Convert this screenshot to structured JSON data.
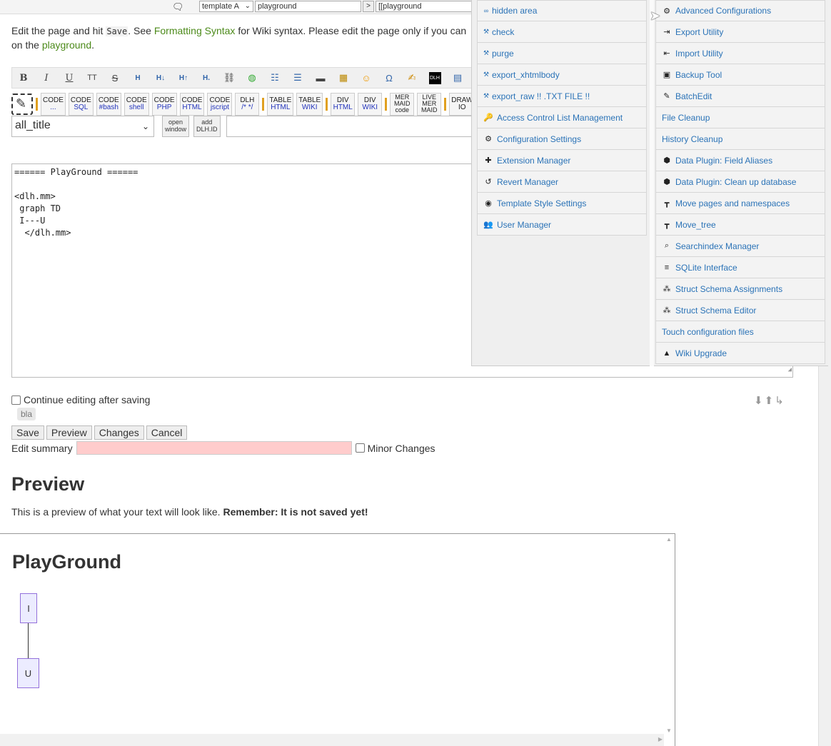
{
  "topbar": {
    "template_select": "template A",
    "page_input": "playground",
    "go_label": ">",
    "link_input": "[[playground"
  },
  "intro": {
    "text_a": "Edit the page and hit ",
    "save_code": "Save",
    "text_b": ". See ",
    "syntax_link": "Formatting Syntax",
    "text_c": " for Wiki syntax. Please edit the page only if you can ",
    "line2_a": "on the ",
    "playground_link": "playground",
    "line2_b": "."
  },
  "toolbar": {
    "format_buttons": [
      "B",
      "I",
      "U",
      "TT",
      "S"
    ],
    "dlh_badge": "DLH",
    "code_buttons": [
      {
        "l1": "CODE",
        "l2": "..."
      },
      {
        "l1": "CODE",
        "l2": "SQL"
      },
      {
        "l1": "CODE",
        "l2": "#bash"
      },
      {
        "l1": "CODE",
        "l2": "shell"
      },
      {
        "l1": "CODE",
        "l2": "PHP"
      },
      {
        "l1": "CODE",
        "l2": "HTML"
      },
      {
        "l1": "CODE",
        "l2": "jscript"
      },
      {
        "l1": "DLH",
        "l2": "/* */"
      }
    ],
    "table_buttons": [
      {
        "l1": "TABLE",
        "l2": "HTML"
      },
      {
        "l1": "TABLE",
        "l2": "WIKI"
      }
    ],
    "div_buttons": [
      {
        "l1": "DIV",
        "l2": "HTML"
      },
      {
        "l1": "DIV",
        "l2": "WIKI"
      }
    ],
    "mermaid_buttons": [
      {
        "l1": "MER",
        "l2": "MAID",
        "l3": "code"
      },
      {
        "l1": "LIVE",
        "l2": "MER",
        "l3": "MAID"
      }
    ],
    "drawio": {
      "l1": "DRAW",
      "l2": "IO"
    },
    "title_select": "all_title",
    "open_window": [
      "open",
      "window"
    ],
    "add_dlh": [
      "add",
      "DLH.ID"
    ]
  },
  "editor": {
    "lines": [
      "====== PlayGround ======",
      "",
      "<dlh.mm>",
      " graph TD",
      " I---U",
      "  </dlh.mm>"
    ]
  },
  "edit_controls": {
    "continue_label": "Continue editing after saving",
    "tag": "bla",
    "save": "Save",
    "preview": "Preview",
    "changes": "Changes",
    "cancel": "Cancel",
    "summary_label": "Edit summary",
    "minor_label": "Minor Changes"
  },
  "preview": {
    "heading": "Preview",
    "note_a": "This is a preview of what your text will look like. ",
    "note_b": "Remember: It is not saved yet!",
    "page_heading": "PlayGround",
    "node_top": "I",
    "node_bottom": "U"
  },
  "admin_menu": {
    "left": [
      {
        "icon": "link-icon",
        "glyph": "∞",
        "label": "hidden area"
      },
      {
        "icon": "wrench-icon",
        "glyph": "⚒",
        "label": "check"
      },
      {
        "icon": "wrench-icon",
        "glyph": "⚒",
        "label": "purge"
      },
      {
        "icon": "wrench-icon",
        "glyph": "⚒",
        "label": "export_xhtmlbody"
      },
      {
        "icon": "wrench-icon",
        "glyph": "⚒",
        "label": "export_raw !! .TXT FILE !!"
      },
      {
        "icon": "key-icon",
        "glyph": "🔑",
        "label": "Access Control List Management"
      },
      {
        "icon": "gear-icon",
        "glyph": "⚙",
        "label": "Configuration Settings"
      },
      {
        "icon": "puzzle-icon",
        "glyph": "✚",
        "label": "Extension Manager"
      },
      {
        "icon": "revert-icon",
        "glyph": "↺",
        "label": "Revert Manager"
      },
      {
        "icon": "palette-icon",
        "glyph": "◉",
        "label": "Template Style Settings"
      },
      {
        "icon": "users-icon",
        "glyph": "👥",
        "label": "User Manager"
      }
    ],
    "right": [
      {
        "icon": "gears-icon",
        "glyph": "⚙",
        "label": "Advanced Configurations"
      },
      {
        "icon": "export-icon",
        "glyph": "⇥",
        "label": "Export Utility"
      },
      {
        "icon": "import-icon",
        "glyph": "⇤",
        "label": "Import Utility"
      },
      {
        "icon": "toolbox-icon",
        "glyph": "▣",
        "label": "Backup Tool"
      },
      {
        "icon": "batch-edit-icon",
        "glyph": "✎",
        "label": "BatchEdit"
      },
      {
        "icon": "",
        "glyph": "",
        "label": "File Cleanup"
      },
      {
        "icon": "",
        "glyph": "",
        "label": "History Cleanup"
      },
      {
        "icon": "hexagon-icon",
        "glyph": "⬢",
        "label": "Data Plugin: Field Aliases"
      },
      {
        "icon": "hexagon-icon",
        "glyph": "⬢",
        "label": "Data Plugin: Clean up database"
      },
      {
        "icon": "paint-roller-icon",
        "glyph": "┳",
        "label": "Move pages and namespaces"
      },
      {
        "icon": "paint-roller-icon",
        "glyph": "┳",
        "label": "Move_tree"
      },
      {
        "icon": "search-index-icon",
        "glyph": "⌕",
        "label": "Searchindex Manager"
      },
      {
        "icon": "database-icon",
        "glyph": "≡",
        "label": "SQLite Interface"
      },
      {
        "icon": "struct-icon",
        "glyph": "⁂",
        "label": "Struct Schema Assignments"
      },
      {
        "icon": "struct-icon",
        "glyph": "⁂",
        "label": "Struct Schema Editor"
      },
      {
        "icon": "",
        "glyph": "",
        "label": "Touch configuration files"
      },
      {
        "icon": "upgrade-icon",
        "glyph": "▲",
        "label": "Wiki Upgrade"
      }
    ]
  }
}
